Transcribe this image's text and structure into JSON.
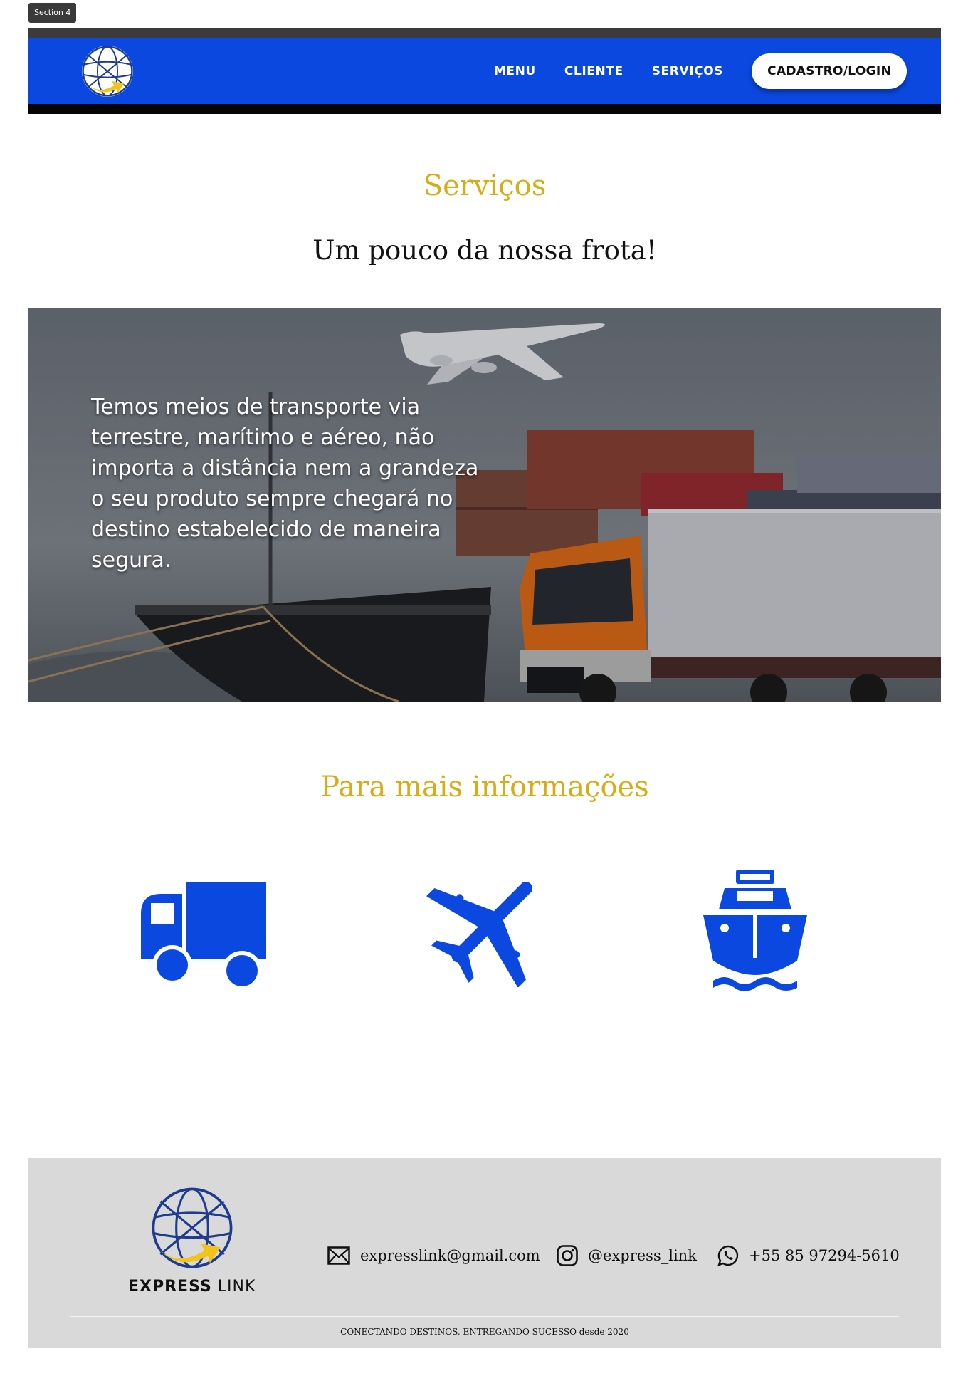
{
  "section_label": "Section 4",
  "header": {
    "logo_icon": "globe-with-arrow-icon",
    "nav": {
      "menu": "MENU",
      "cliente": "CLIENTE",
      "servicos": "SERVIÇOS"
    },
    "login_button": "CADASTRO/LOGIN"
  },
  "services": {
    "title": "Serviços",
    "subtitle": "Um pouco da nossa frota!"
  },
  "hero": {
    "text": "Temos meios de transporte via terrestre, marítimo e aéreo, não importa a distância nem a grandeza o seu produto sempre chegará no destino estabelecido de maneira segura."
  },
  "info": {
    "title": "Para mais informações",
    "icons": [
      "truck-icon",
      "airplane-icon",
      "ship-icon"
    ]
  },
  "footer": {
    "brand_bold": "EXPRESS",
    "brand_light": "LINK",
    "email": "expresslink@gmail.com",
    "instagram": "@express_link",
    "phone": "+55 85 97294-5610",
    "tagline": "CONECTANDO DESTINOS, ENTREGANDO SUCESSO desde 2020"
  },
  "colors": {
    "header_blue": "#0a48e0",
    "gold": "#d8ac16",
    "icon_blue": "#0a48e0",
    "footer_gray": "#d9d9d9"
  }
}
